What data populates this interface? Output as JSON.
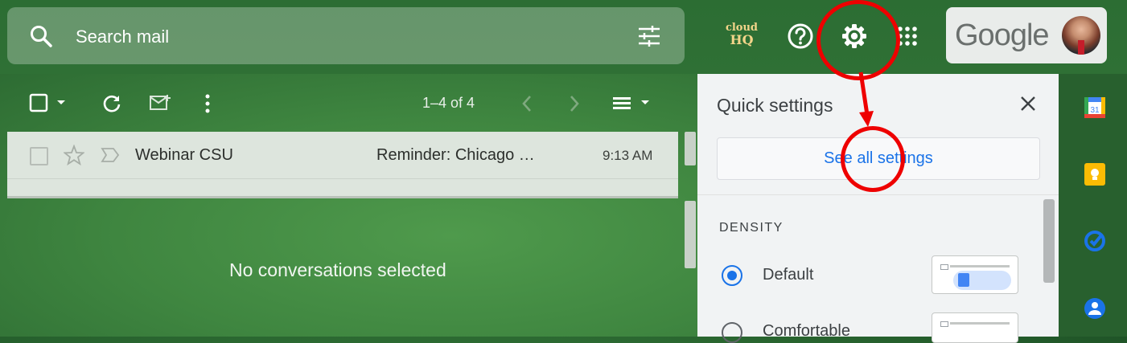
{
  "search": {
    "placeholder": "Search mail"
  },
  "topbar": {
    "cloudhq_line1": "cloud",
    "cloudhq_line2": "HQ",
    "google_logo": "Google"
  },
  "toolbar": {
    "pager": "1–4 of 4"
  },
  "email_list": {
    "rows": [
      {
        "sender": "Webinar CSU",
        "subject": "Reminder: Chicago …",
        "time": "9:13 AM"
      }
    ],
    "empty_message": "No conversations selected"
  },
  "quick_settings": {
    "title": "Quick settings",
    "see_all_label": "See all settings",
    "density_heading": "DENSITY",
    "options": [
      {
        "label": "Default",
        "selected": true
      },
      {
        "label": "Comfortable",
        "selected": false
      }
    ]
  },
  "side_panel": {
    "calendar_day": "31"
  },
  "colors": {
    "background": "#3f8640",
    "annotation": "#e00000",
    "link": "#1a73e8"
  },
  "icons": [
    "search-icon",
    "filter-icon",
    "help-icon",
    "gear-icon",
    "apps-icon",
    "select-checkbox",
    "caret-down-icon",
    "refresh-icon",
    "mark-read-icon",
    "more-vert-icon",
    "chevron-left-icon",
    "chevron-right-icon",
    "split-pane-icon",
    "star-icon",
    "importance-icon",
    "close-icon",
    "calendar-icon",
    "keep-icon",
    "tasks-icon",
    "contacts-icon"
  ]
}
